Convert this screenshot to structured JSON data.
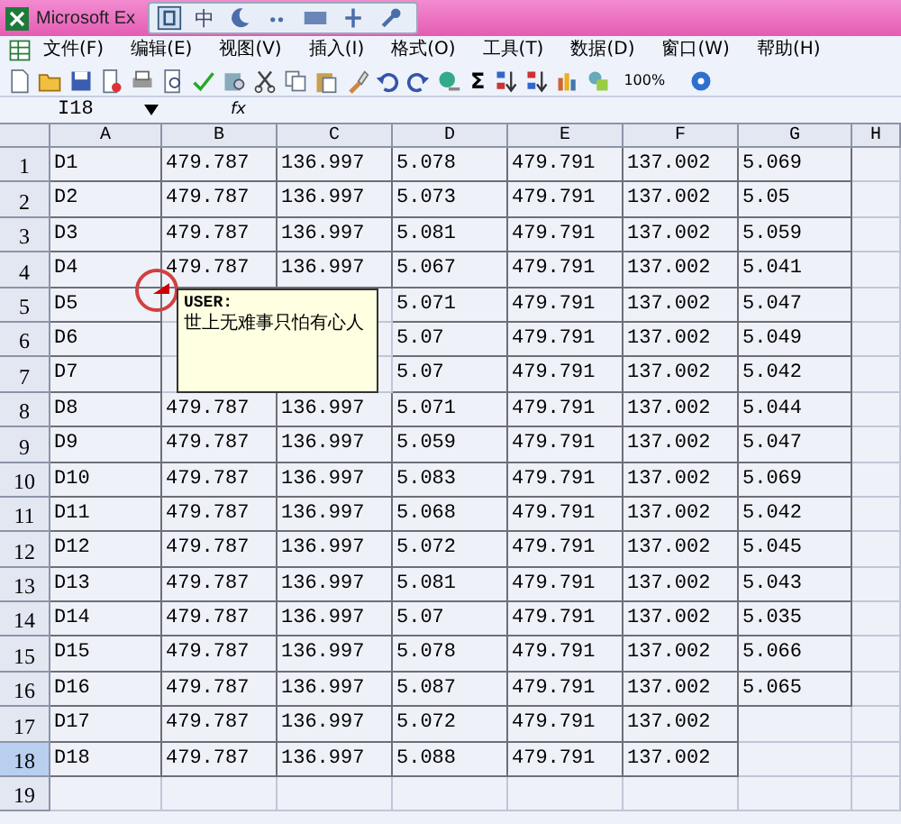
{
  "window": {
    "title": "Microsoft Ex"
  },
  "ime_bar": {
    "mode": "中"
  },
  "menu": [
    "文件(F)",
    "编辑(E)",
    "视图(V)",
    "插入(I)",
    "格式(O)",
    "工具(T)",
    "数据(D)",
    "窗口(W)",
    "帮助(H)"
  ],
  "toolbar": {
    "sum": "Σ",
    "zoom": "100%"
  },
  "formula_bar": {
    "name_box": "I18",
    "fx": "fx"
  },
  "columns": [
    "A",
    "B",
    "C",
    "D",
    "E",
    "F",
    "G",
    "H"
  ],
  "rows": [
    {
      "label": "1",
      "selected": false,
      "cells": [
        "D1",
        "479.787",
        "136.997",
        "5.078",
        "479.791",
        "137.002",
        "5.069"
      ]
    },
    {
      "label": "2",
      "selected": false,
      "cells": [
        "D2",
        "479.787",
        "136.997",
        "5.073",
        "479.791",
        "137.002",
        "5.05"
      ]
    },
    {
      "label": "3",
      "selected": false,
      "cells": [
        "D3",
        "479.787",
        "136.997",
        "5.081",
        "479.791",
        "137.002",
        "5.059"
      ]
    },
    {
      "label": "4",
      "selected": false,
      "cells": [
        "D4",
        "479.787",
        "136.997",
        "5.067",
        "479.791",
        "137.002",
        "5.041"
      ]
    },
    {
      "label": "5",
      "selected": false,
      "cells": [
        "D5",
        null,
        null,
        "5.071",
        "479.791",
        "137.002",
        "5.047"
      ]
    },
    {
      "label": "6",
      "selected": false,
      "cells": [
        "D6",
        null,
        null,
        "5.07",
        "479.791",
        "137.002",
        "5.049"
      ]
    },
    {
      "label": "7",
      "selected": false,
      "cells": [
        "D7",
        null,
        null,
        "5.07",
        "479.791",
        "137.002",
        "5.042"
      ]
    },
    {
      "label": "8",
      "selected": false,
      "cells": [
        "D8",
        "479.787",
        "136.997",
        "5.071",
        "479.791",
        "137.002",
        "5.044"
      ]
    },
    {
      "label": "9",
      "selected": false,
      "cells": [
        "D9",
        "479.787",
        "136.997",
        "5.059",
        "479.791",
        "137.002",
        "5.047"
      ]
    },
    {
      "label": "10",
      "selected": false,
      "cells": [
        "D10",
        "479.787",
        "136.997",
        "5.083",
        "479.791",
        "137.002",
        "5.069"
      ]
    },
    {
      "label": "11",
      "selected": false,
      "cells": [
        "D11",
        "479.787",
        "136.997",
        "5.068",
        "479.791",
        "137.002",
        "5.042"
      ]
    },
    {
      "label": "12",
      "selected": false,
      "cells": [
        "D12",
        "479.787",
        "136.997",
        "5.072",
        "479.791",
        "137.002",
        "5.045"
      ]
    },
    {
      "label": "13",
      "selected": false,
      "cells": [
        "D13",
        "479.787",
        "136.997",
        "5.081",
        "479.791",
        "137.002",
        "5.043"
      ]
    },
    {
      "label": "14",
      "selected": false,
      "cells": [
        "D14",
        "479.787",
        "136.997",
        "5.07",
        "479.791",
        "137.002",
        "5.035"
      ]
    },
    {
      "label": "15",
      "selected": false,
      "cells": [
        "D15",
        "479.787",
        "136.997",
        "5.078",
        "479.791",
        "137.002",
        "5.066"
      ]
    },
    {
      "label": "16",
      "selected": false,
      "cells": [
        "D16",
        "479.787",
        "136.997",
        "5.087",
        "479.791",
        "137.002",
        "5.065"
      ]
    },
    {
      "label": "17",
      "selected": false,
      "cells": [
        "D17",
        "479.787",
        "136.997",
        "5.072",
        "479.791",
        "137.002",
        null
      ]
    },
    {
      "label": "18",
      "selected": true,
      "cells": [
        "D18",
        "479.787",
        "136.997",
        "5.088",
        "479.791",
        "137.002",
        null
      ]
    },
    {
      "label": "19",
      "selected": false,
      "cells": [
        null,
        null,
        null,
        null,
        null,
        null,
        null
      ]
    }
  ],
  "comment": {
    "author": "USER:",
    "text": "世上无难事只怕有心人"
  }
}
